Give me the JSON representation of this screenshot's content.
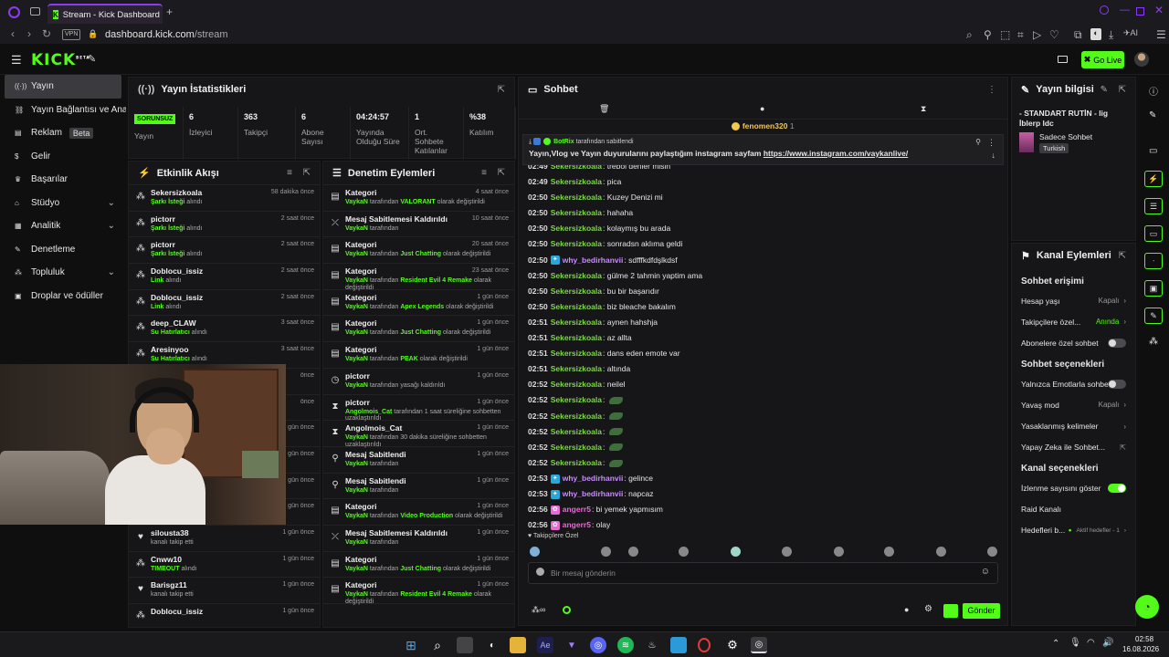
{
  "browser": {
    "tab_title": "Stream - Kick Dashboard",
    "url_host": "dashboard.kick.com",
    "url_path": "/stream",
    "vpn": "VPN",
    "ai": "AI"
  },
  "header": {
    "logo": "KICK",
    "logo_sup": "BETA",
    "go_live": "Go Live"
  },
  "sidebar": {
    "items": [
      {
        "label": "Yayın",
        "icon": "stream-icon"
      },
      {
        "label": "Yayın Bağlantısı ve Anahtar",
        "icon": "link-icon"
      },
      {
        "label": "Reklam",
        "icon": "ad-icon",
        "badge": "Beta"
      },
      {
        "label": "Gelir",
        "icon": "money-icon"
      },
      {
        "label": "Başarılar",
        "icon": "trophy-icon"
      },
      {
        "label": "Stüdyo",
        "icon": "studio-icon",
        "chevron": true
      },
      {
        "label": "Analitik",
        "icon": "chart-icon",
        "chevron": true
      },
      {
        "label": "Denetleme",
        "icon": "wrench-icon"
      },
      {
        "label": "Topluluk",
        "icon": "community-icon",
        "chevron": true
      },
      {
        "label": "Droplar ve ödüller",
        "icon": "gift-icon"
      }
    ]
  },
  "stats": {
    "title": "Yayın İstatistikleri",
    "badge": "SORUNSUZ",
    "badge_label": "Yayın",
    "cells": [
      {
        "value": "6",
        "label": "İzleyici"
      },
      {
        "value": "363",
        "label": "Takipçi"
      },
      {
        "value": "6",
        "label": "Abone Sayısı"
      },
      {
        "value": "04:24:57",
        "label": "Yayında Olduğu Süre"
      },
      {
        "value": "1",
        "label": "Ort. Sohbete Katılanlar"
      },
      {
        "value": "%38",
        "label": "Katılım"
      }
    ]
  },
  "activity": {
    "title": "Etkinlik Akışı",
    "items": [
      {
        "user": "Sekersizkoala",
        "time": "58 dakika önce",
        "hl": "Şarkı İsteği",
        "rest": " alındı"
      },
      {
        "user": "pictorr",
        "time": "2 saat önce",
        "hl": "Şarkı İsteği",
        "rest": " alındı"
      },
      {
        "user": "pictorr",
        "time": "2 saat önce",
        "hl": "Şarkı İsteği",
        "rest": " alındı"
      },
      {
        "user": "Doblocu_issiz",
        "time": "2 saat önce",
        "hl": "Link",
        "rest": " alındı"
      },
      {
        "user": "Doblocu_issiz",
        "time": "2 saat önce",
        "hl": "Link",
        "rest": " alındı"
      },
      {
        "user": "deep_CLAW",
        "time": "3 saat önce",
        "hl": "Su Hatırlatıcı",
        "rest": " alındı"
      },
      {
        "user": "Aresinyoo",
        "time": "3 saat önce",
        "hl": "Su Hatırlatıcı",
        "rest": " alındı"
      },
      {
        "user": "",
        "time": "önce",
        "hl": "",
        "rest": ""
      },
      {
        "user": "",
        "time": "önce",
        "hl": "",
        "rest": ""
      },
      {
        "user": "",
        "time": "1 gün önce",
        "hl": "",
        "rest": ""
      },
      {
        "user": "",
        "time": "1 gün önce",
        "hl": "",
        "rest": ""
      },
      {
        "user": "",
        "time": "1 gün önce",
        "hl": "",
        "rest": ""
      },
      {
        "user": "",
        "time": "1 gün önce",
        "hl": "",
        "rest": ""
      },
      {
        "user": "silousta38",
        "time": "1 gün önce",
        "hl": "",
        "rest": "kanalı takip etti",
        "heart": true
      },
      {
        "user": "Cnww10",
        "time": "1 gün önce",
        "hl": "TIMEOUT",
        "rest": " alındı"
      },
      {
        "user": "Barisgz11",
        "time": "1 gün önce",
        "hl": "",
        "rest": "kanalı takip etti",
        "heart": true
      },
      {
        "user": "Doblocu_issiz",
        "time": "1 gün önce",
        "hl": "",
        "rest": ""
      }
    ]
  },
  "moderation": {
    "title": "Denetim Eylemleri",
    "items": [
      {
        "title": "Kategori",
        "time": "4 saat önce",
        "who": "VaykaN",
        "mid": " tarafından ",
        "hl": "VALORANT",
        "rest": " olarak değiştirildi",
        "icon": "category-icon"
      },
      {
        "title": "Mesaj Sabitlemesi Kaldırıldı",
        "time": "10 saat önce",
        "who": "VaykaN",
        "mid": " tarafından",
        "hl": "",
        "rest": "",
        "icon": "unpin-icon"
      },
      {
        "title": "Kategori",
        "time": "20 saat önce",
        "who": "VaykaN",
        "mid": " tarafından ",
        "hl": "Just Chatting",
        "rest": " olarak değiştirildi",
        "icon": "category-icon"
      },
      {
        "title": "Kategori",
        "time": "23 saat önce",
        "who": "VaykaN",
        "mid": " tarafından ",
        "hl": "Resident Evil 4 Remake",
        "rest": " olarak değiştirildi",
        "icon": "category-icon"
      },
      {
        "title": "Kategori",
        "time": "1 gün önce",
        "who": "VaykaN",
        "mid": " tarafından ",
        "hl": "Apex Legends",
        "rest": " olarak değiştirildi",
        "icon": "category-icon"
      },
      {
        "title": "Kategori",
        "time": "1 gün önce",
        "who": "VaykaN",
        "mid": " tarafından ",
        "hl": "Just Chatting",
        "rest": " olarak değiştirildi",
        "icon": "category-icon"
      },
      {
        "title": "Kategori",
        "time": "1 gün önce",
        "who": "VaykaN",
        "mid": " tarafından ",
        "hl": "PEAK",
        "rest": " olarak değiştirildi",
        "icon": "category-icon"
      },
      {
        "title": "pictorr",
        "time": "1 gün önce",
        "who": "VaykaN",
        "mid": " tarafından yasağı kaldırıldı",
        "hl": "",
        "rest": "",
        "icon": "clock-icon"
      },
      {
        "title": "pictorr",
        "time": "1 gün önce",
        "who": "Angolmois_Cat",
        "mid": " tarafından 1 saat süreliğine sohbetten uzaklaştırıldı",
        "hl": "",
        "rest": "",
        "icon": "hourglass-icon"
      },
      {
        "title": "Angolmois_Cat",
        "time": "1 gün önce",
        "who": "VaykaN",
        "mid": " tarafından 30 dakika süreliğine sohbetten uzaklaştırıldı",
        "hl": "",
        "rest": "",
        "icon": "hourglass-icon"
      },
      {
        "title": "Mesaj Sabitlendi",
        "time": "1 gün önce",
        "who": "VaykaN",
        "mid": " tarafından",
        "hl": "",
        "rest": "",
        "icon": "pin-icon"
      },
      {
        "title": "Mesaj Sabitlendi",
        "time": "1 gün önce",
        "who": "VaykaN",
        "mid": " tarafından",
        "hl": "",
        "rest": "",
        "icon": "pin-icon"
      },
      {
        "title": "Kategori",
        "time": "1 gün önce",
        "who": "VaykaN",
        "mid": " tarafından ",
        "hl": "Video Production",
        "rest": " olarak değiştirildi",
        "icon": "category-icon"
      },
      {
        "title": "Mesaj Sabitlemesi Kaldırıldı",
        "time": "1 gün önce",
        "who": "VaykaN",
        "mid": " tarafından",
        "hl": "",
        "rest": "",
        "icon": "unpin-icon"
      },
      {
        "title": "Kategori",
        "time": "1 gün önce",
        "who": "VaykaN",
        "mid": " tarafından ",
        "hl": "Just Chatting",
        "rest": " olarak değiştirildi",
        "icon": "category-icon"
      },
      {
        "title": "Kategori",
        "time": "1 gün önce",
        "who": "VaykaN",
        "mid": " tarafından ",
        "hl": "Resident Evil 4 Remake",
        "rest": " olarak değiştirildi",
        "icon": "category-icon"
      }
    ]
  },
  "chat": {
    "title": "Sohbet",
    "top_user": "fenomen320",
    "top_count": "1",
    "pinned": {
      "by": "BotRix",
      "by_suffix": " tarafından sabitlendi",
      "text": "Yayın,Vlog ve Yayın duyurularını paylaştığım instagram sayfam ",
      "link": "https://www.instagram.com/vaykanlive/"
    },
    "messages": [
      {
        "ts": "02:49",
        "user": "Sekersizkoala",
        "color": "#7dd848",
        "text": "trebol deriler misin"
      },
      {
        "ts": "02:49",
        "user": "Sekersizkoala",
        "color": "#7dd848",
        "text": "pica"
      },
      {
        "ts": "02:50",
        "user": "Sekersizkoala",
        "color": "#7dd848",
        "text": "Kuzey Denizi mi"
      },
      {
        "ts": "02:50",
        "user": "Sekersizkoala",
        "color": "#7dd848",
        "text": "hahaha"
      },
      {
        "ts": "02:50",
        "user": "Sekersizkoala",
        "color": "#7dd848",
        "text": "kolaymış bu arada"
      },
      {
        "ts": "02:50",
        "user": "Sekersizkoala",
        "color": "#7dd848",
        "text": "sonradsn aklıma geldi"
      },
      {
        "ts": "02:50",
        "user": "why_bedirhanvii",
        "color": "#c98bff",
        "text": "sdfffkdfdşlkdsf",
        "badge": true
      },
      {
        "ts": "02:50",
        "user": "Sekersizkoala",
        "color": "#7dd848",
        "text": "gülme 2 tahmin yaptim ama"
      },
      {
        "ts": "02:50",
        "user": "Sekersizkoala",
        "color": "#7dd848",
        "text": "bu bir başarıdır"
      },
      {
        "ts": "02:50",
        "user": "Sekersizkoala",
        "color": "#7dd848",
        "text": "biz bleache bakalım"
      },
      {
        "ts": "02:51",
        "user": "Sekersizkoala",
        "color": "#7dd848",
        "text": "aynen hahshja"
      },
      {
        "ts": "02:51",
        "user": "Sekersizkoala",
        "color": "#7dd848",
        "text": "az allta"
      },
      {
        "ts": "02:51",
        "user": "Sekersizkoala",
        "color": "#7dd848",
        "text": "dans eden emote var"
      },
      {
        "ts": "02:51",
        "user": "Sekersizkoala",
        "color": "#7dd848",
        "text": "altında"
      },
      {
        "ts": "02:52",
        "user": "Sekersizkoala",
        "color": "#7dd848",
        "text": "neilel"
      },
      {
        "ts": "02:52",
        "user": "Sekersizkoala",
        "color": "#7dd848",
        "text": "",
        "emote": true
      },
      {
        "ts": "02:52",
        "user": "Sekersizkoala",
        "color": "#7dd848",
        "text": "",
        "emote": true
      },
      {
        "ts": "02:52",
        "user": "Sekersizkoala",
        "color": "#7dd848",
        "text": "",
        "emote": true
      },
      {
        "ts": "02:52",
        "user": "Sekersizkoala",
        "color": "#7dd848",
        "text": "",
        "emote": true
      },
      {
        "ts": "02:52",
        "user": "Sekersizkoala",
        "color": "#7dd848",
        "text": "",
        "emote": true
      },
      {
        "ts": "02:53",
        "user": "why_bedirhanvii",
        "color": "#c98bff",
        "text": "gelince",
        "badge": true
      },
      {
        "ts": "02:53",
        "user": "why_bedirhanvii",
        "color": "#c98bff",
        "text": "napcaz",
        "badge": true
      },
      {
        "ts": "02:56",
        "user": "angerr5",
        "color": "#e76bd6",
        "text": "bi yemek yapmısım",
        "badge2": true
      },
      {
        "ts": "02:56",
        "user": "angerr5",
        "color": "#e76bd6",
        "text": "olay",
        "badge2": true
      }
    ],
    "followers_label": "Takipçilere Özel",
    "placeholder": "Bir mesaj gönderin",
    "send": "Gönder"
  },
  "stream_info": {
    "title": "Yayın bilgisi",
    "stream_title": "- STANDART RUTİN - lig İblerp ldc",
    "category": "Sadece Sohbet",
    "language": "Turkish"
  },
  "channel_actions": {
    "title": "Kanal Eylemleri",
    "chat_access": "Sohbet erişimi",
    "age_label": "Hesap yaşı",
    "age_value": "Kapalı",
    "follow_label": "Takipçilere özel...",
    "follow_value": "Anında",
    "subs_label": "Abonelere özel sohbet",
    "chat_options": "Sohbet seçenekleri",
    "emote_label": "Yalnızca Emotlarla sohbet",
    "slow_label": "Yavaş mod",
    "slow_value": "Kapalı",
    "banned_label": "Yasaklanmış kelimeler",
    "ai_label": "Yapay Zeka ile Sohbet...",
    "channel_options": "Kanal seçenekleri",
    "viewers_label": "İzlenme sayısını göster",
    "raid_label": "Raid Kanalı",
    "goals_label": "Hedefleri b...",
    "goals_value": "Aktif hedefler - 1"
  },
  "taskbar": {
    "time": "02:58",
    "date": "16.08.2026"
  },
  "colors": {
    "accent": "#53fc18",
    "opera": "#8c3cf0"
  }
}
